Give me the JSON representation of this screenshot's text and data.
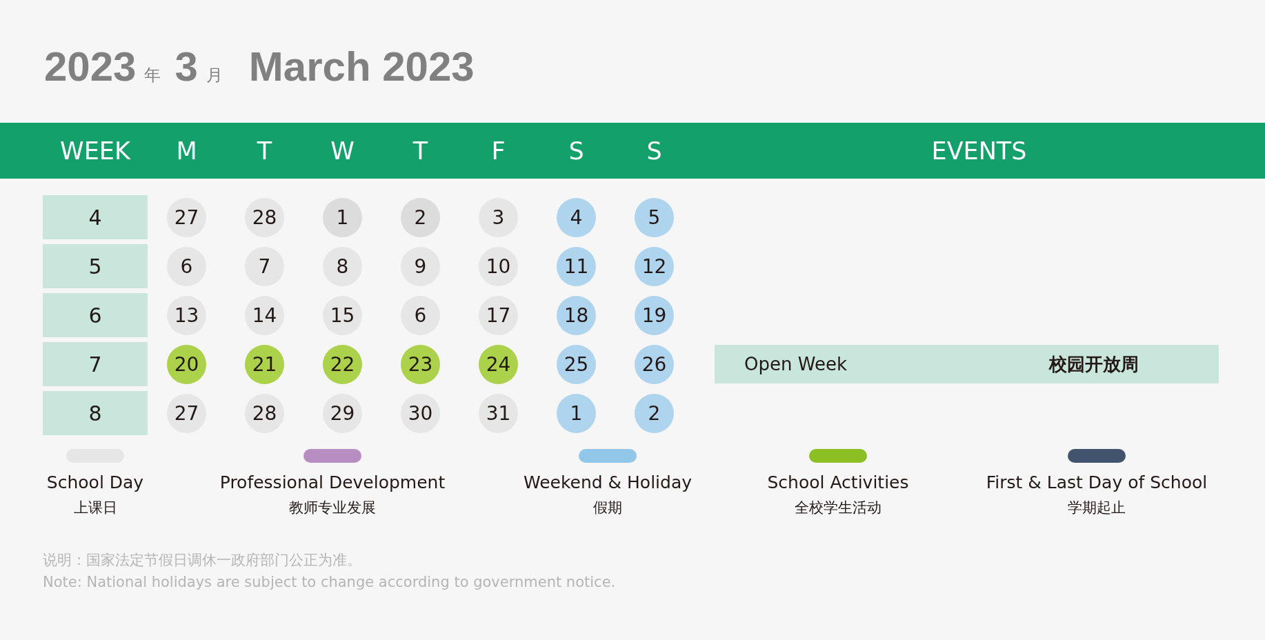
{
  "title": {
    "year": "2023",
    "year_unit": "年",
    "month": "3",
    "month_unit": "月",
    "english": "March 2023"
  },
  "header": {
    "week": "WEEK",
    "days": [
      "M",
      "T",
      "W",
      "T",
      "F",
      "S",
      "S"
    ],
    "events": "EVENTS"
  },
  "weeks": [
    {
      "week": "4",
      "days": [
        {
          "n": "27",
          "color": "#e6e6e6"
        },
        {
          "n": "28",
          "color": "#e6e6e6"
        },
        {
          "n": "1",
          "color": "#dcdcdc"
        },
        {
          "n": "2",
          "color": "#dcdcdc"
        },
        {
          "n": "3",
          "color": "#e6e6e6"
        },
        {
          "n": "4",
          "color": "#afd4ee"
        },
        {
          "n": "5",
          "color": "#afd4ee"
        }
      ]
    },
    {
      "week": "5",
      "days": [
        {
          "n": "6",
          "color": "#e6e6e6"
        },
        {
          "n": "7",
          "color": "#e6e6e6"
        },
        {
          "n": "8",
          "color": "#e6e6e6"
        },
        {
          "n": "9",
          "color": "#e6e6e6"
        },
        {
          "n": "10",
          "color": "#e6e6e6"
        },
        {
          "n": "11",
          "color": "#afd4ee"
        },
        {
          "n": "12",
          "color": "#afd4ee"
        }
      ]
    },
    {
      "week": "6",
      "days": [
        {
          "n": "13",
          "color": "#e6e6e6"
        },
        {
          "n": "14",
          "color": "#e6e6e6"
        },
        {
          "n": "15",
          "color": "#e6e6e6"
        },
        {
          "n": "6",
          "color": "#e6e6e6"
        },
        {
          "n": "17",
          "color": "#e6e6e6"
        },
        {
          "n": "18",
          "color": "#afd4ee"
        },
        {
          "n": "19",
          "color": "#afd4ee"
        }
      ]
    },
    {
      "week": "7",
      "days": [
        {
          "n": "20",
          "color": "#acd14a"
        },
        {
          "n": "21",
          "color": "#acd14a"
        },
        {
          "n": "22",
          "color": "#acd14a"
        },
        {
          "n": "23",
          "color": "#acd14a"
        },
        {
          "n": "24",
          "color": "#acd14a"
        },
        {
          "n": "25",
          "color": "#afd4ee"
        },
        {
          "n": "26",
          "color": "#afd4ee"
        }
      ],
      "event": {
        "en": "Open Week",
        "zh": "校园开放周"
      }
    },
    {
      "week": "8",
      "days": [
        {
          "n": "27",
          "color": "#e6e6e6"
        },
        {
          "n": "28",
          "color": "#e6e6e6"
        },
        {
          "n": "29",
          "color": "#e6e6e6"
        },
        {
          "n": "30",
          "color": "#e6e6e6"
        },
        {
          "n": "31",
          "color": "#e6e6e6"
        },
        {
          "n": "1",
          "color": "#afd4ee"
        },
        {
          "n": "2",
          "color": "#afd4ee"
        }
      ]
    }
  ],
  "legend": [
    {
      "en": "School Day",
      "zh": "上课日",
      "color": "#e6e6e6"
    },
    {
      "en": "Professional Development",
      "zh": "教师专业发展",
      "color": "#b88dc2"
    },
    {
      "en": "Weekend & Holiday",
      "zh": "假期",
      "color": "#92c7ea"
    },
    {
      "en": "School Activities",
      "zh": "全校学生活动",
      "color": "#8cbf23"
    },
    {
      "en": "First & Last Day of School",
      "zh": "学期起止",
      "color": "#42546d"
    }
  ],
  "notes": [
    "说明：国家法定节假日调休一政府部门公正为准。",
    "Note: National holidays are subject to change according to government notice."
  ]
}
